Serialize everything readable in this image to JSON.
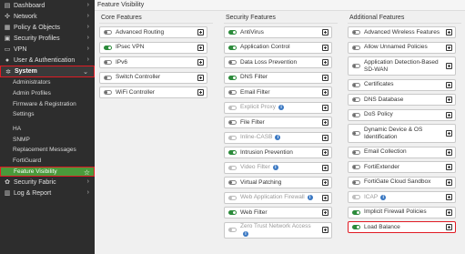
{
  "sidebar": {
    "items": [
      {
        "label": "Dashboard",
        "icon": "dashboard-icon",
        "glyph": "▤"
      },
      {
        "label": "Network",
        "icon": "network-icon",
        "glyph": "✣"
      },
      {
        "label": "Policy & Objects",
        "icon": "policy-icon",
        "glyph": "▦"
      },
      {
        "label": "Security Profiles",
        "icon": "lock-icon",
        "glyph": "▣"
      },
      {
        "label": "VPN",
        "icon": "monitor-icon",
        "glyph": "▭"
      },
      {
        "label": "User & Authentication",
        "icon": "user-icon",
        "glyph": "●"
      }
    ],
    "system": {
      "label": "System",
      "icon": "gear-icon",
      "glyph": "✲"
    },
    "system_sub_a": [
      "Administrators",
      "Admin Profiles",
      "Firmware & Registration",
      "Settings"
    ],
    "system_sub_b": [
      "HA",
      "SNMP",
      "Replacement Messages",
      "FortiGuard"
    ],
    "active_sub": "Feature Visibility",
    "bottom_items": [
      {
        "label": "Security Fabric",
        "icon": "fabric-icon",
        "glyph": "✿"
      },
      {
        "label": "Log & Report",
        "icon": "chart-icon",
        "glyph": "▥"
      }
    ]
  },
  "main": {
    "title": "Feature Visibility",
    "columns": [
      {
        "title": "Core Features",
        "features": [
          {
            "label": "Advanced Routing",
            "state": "off"
          },
          {
            "label": "IPsec VPN",
            "state": "on"
          },
          {
            "label": "IPv6",
            "state": "off"
          },
          {
            "label": "Switch Controller",
            "state": "off"
          },
          {
            "label": "WiFi Controller",
            "state": "off"
          }
        ]
      },
      {
        "title": "Security Features",
        "features": [
          {
            "label": "AntiVirus",
            "state": "on"
          },
          {
            "label": "Application Control",
            "state": "on"
          },
          {
            "label": "Data Loss Prevention",
            "state": "off"
          },
          {
            "label": "DNS Filter",
            "state": "on"
          },
          {
            "label": "Email Filter",
            "state": "off"
          },
          {
            "label": "Explicit Proxy",
            "state": "disabled",
            "info": true
          },
          {
            "label": "File Filter",
            "state": "off"
          },
          {
            "label": "Inline-CASB",
            "state": "disabled",
            "info": true
          },
          {
            "label": "Intrusion Prevention",
            "state": "on"
          },
          {
            "label": "Video Filter",
            "state": "disabled",
            "info": true
          },
          {
            "label": "Virtual Patching",
            "state": "off"
          },
          {
            "label": "Web Application Firewall",
            "state": "disabled",
            "info": true
          },
          {
            "label": "Web Filter",
            "state": "on"
          },
          {
            "label": "Zero Trust Network Access",
            "state": "disabled",
            "info": true
          }
        ]
      },
      {
        "title": "Additional Features",
        "features": [
          {
            "label": "Advanced Wireless Features",
            "state": "off"
          },
          {
            "label": "Allow Unnamed Policies",
            "state": "off"
          },
          {
            "label": "Application Detection-Based SD-WAN",
            "state": "off",
            "tall": true
          },
          {
            "label": "Certificates",
            "state": "off"
          },
          {
            "label": "DNS Database",
            "state": "off"
          },
          {
            "label": "DoS Policy",
            "state": "off"
          },
          {
            "label": "Dynamic Device & OS Identification",
            "state": "off",
            "tall": true
          },
          {
            "label": "Email Collection",
            "state": "off"
          },
          {
            "label": "FortiExtender",
            "state": "off"
          },
          {
            "label": "FortiGate Cloud Sandbox",
            "state": "off"
          },
          {
            "label": "ICAP",
            "state": "disabled",
            "info": true
          },
          {
            "label": "Implicit Firewall Policies",
            "state": "on"
          },
          {
            "label": "Load Balance",
            "state": "on",
            "highlight": true
          }
        ]
      }
    ]
  }
}
